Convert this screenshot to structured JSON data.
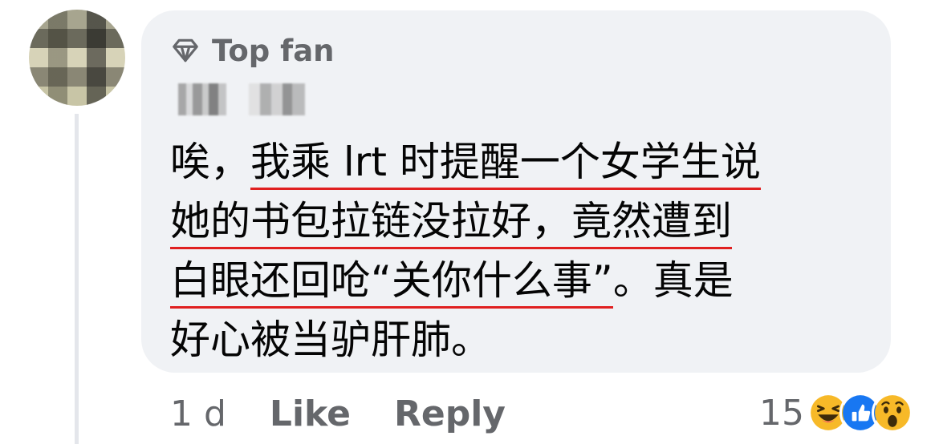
{
  "comment": {
    "badge_label": "Top fan",
    "lines": [
      {
        "pre": "唉，",
        "underlined": "我乘 lrt 时提醒一个女学生说",
        "post": ""
      },
      {
        "pre": "",
        "underlined": "她的书包拉链没拉好，竟然遭到",
        "post": ""
      },
      {
        "pre": "",
        "underlined": "白眼还回呛“关你什么事”",
        "post": "。真是"
      },
      {
        "pre": "好心被当驴肝肺。",
        "underlined": "",
        "post": ""
      }
    ]
  },
  "footer": {
    "time": "1 d",
    "like_label": "Like",
    "reply_label": "Reply",
    "reaction_count": "15",
    "reaction_icons": [
      "haha-icon",
      "like-icon",
      "wow-icon"
    ]
  },
  "colors": {
    "bubble_bg": "#f0f2f5",
    "secondary_text": "#65676b",
    "underline": "#e02020",
    "like_blue": "#1877f2",
    "reaction_yellow": "#f7b928"
  }
}
